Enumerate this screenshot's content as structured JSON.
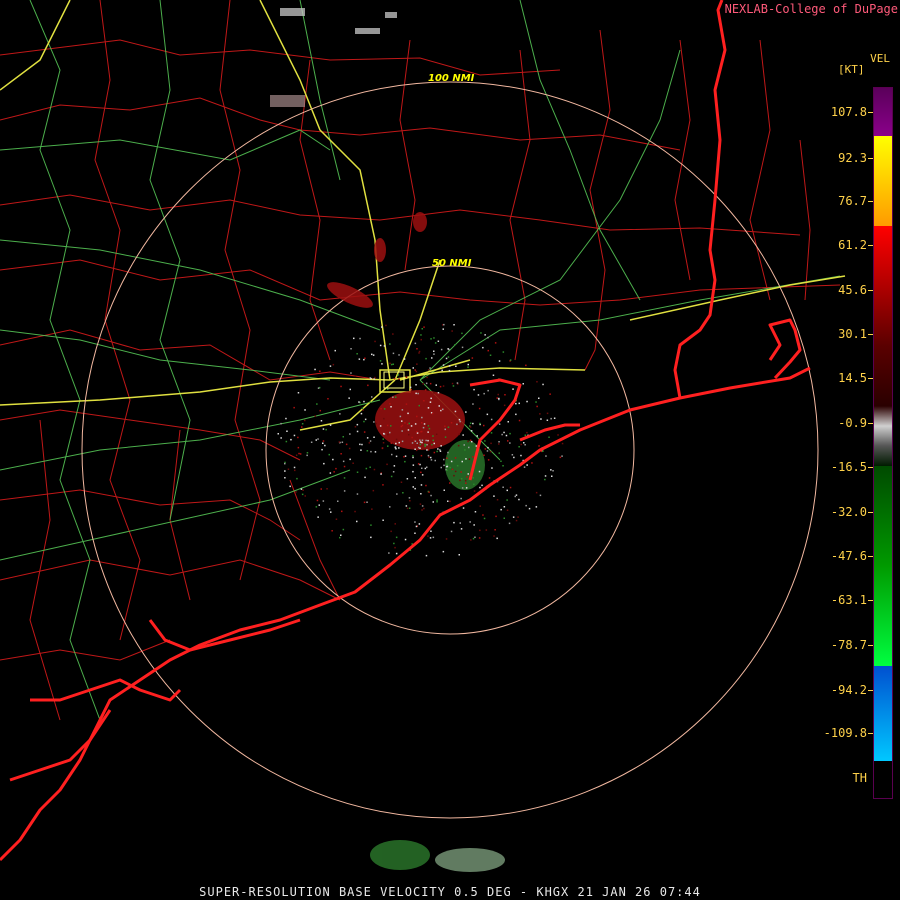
{
  "header": {
    "credit": "NEXLAB-College of DuPage"
  },
  "map": {
    "range_rings": [
      {
        "label": "50 NMI"
      },
      {
        "label": "100 NMI"
      }
    ],
    "colors": {
      "county_lines": "#c01818",
      "state_highway": "#55c255",
      "interstate": "#e0e040",
      "coastline": "#ff2020",
      "range_ring": "#f2b8a0"
    }
  },
  "legend": {
    "product": "VEL",
    "unit": "[KT]",
    "ticks": [
      "107.8",
      "92.3",
      "76.7",
      "61.2",
      "45.6",
      "30.1",
      "14.5",
      "-0.9",
      "-16.5",
      "-32.0",
      "-47.6",
      "-63.1",
      "-78.7",
      "-94.2",
      "-109.8",
      "TH"
    ],
    "colors": {
      "purple": "#7a007a",
      "yellow": "#ffff00",
      "orange": "#ff9a00",
      "red": "#ff0000",
      "dark_red": "#5a0000",
      "gray": "#8c8c8c",
      "dark_green": "#004a00",
      "green": "#00ff40",
      "blue": "#0070ff",
      "cyan": "#00c8ff"
    }
  },
  "footer": {
    "product_line": "SUPER-RESOLUTION BASE VELOCITY 0.5 DEG - KHGX 21 JAN 26 07:44"
  }
}
